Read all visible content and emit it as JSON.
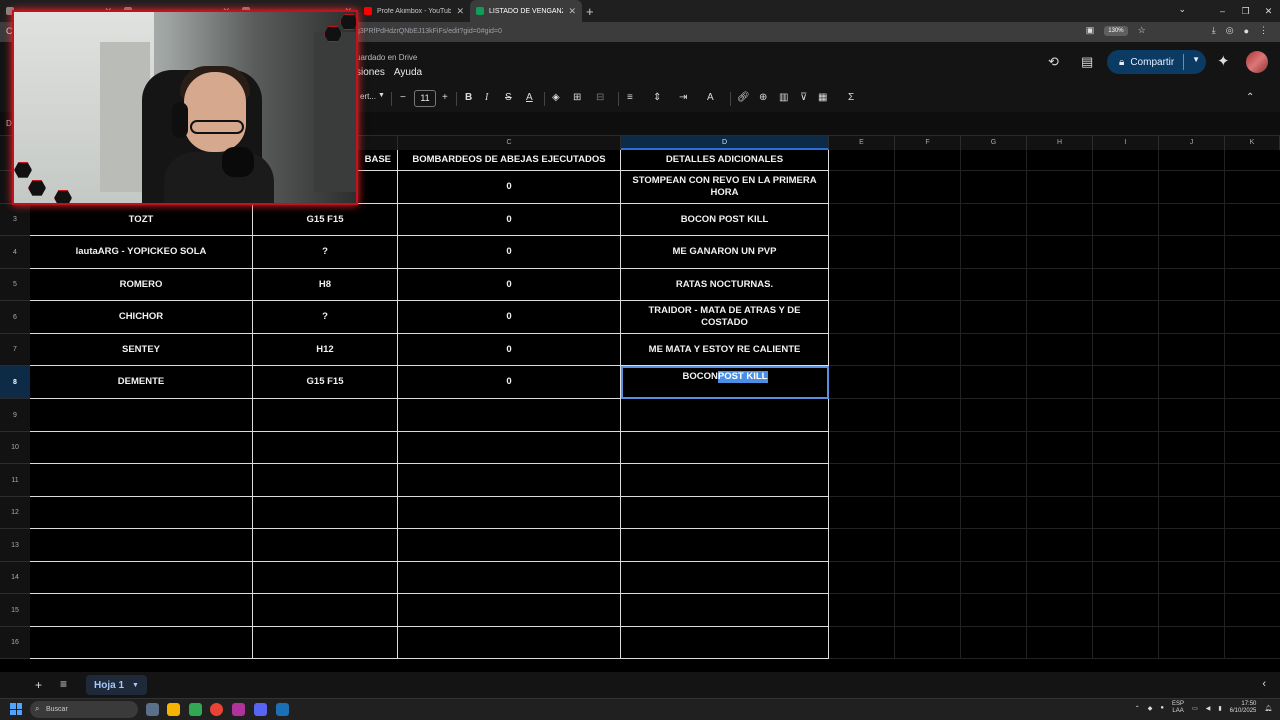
{
  "browser": {
    "tabs": [
      {
        "label": "Profe Akimbox - YouTube",
        "color": "#ff0000",
        "active": false
      },
      {
        "label": "LISTADO DE VENGANZA DE AB",
        "color": "#0f9d58",
        "active": true
      }
    ],
    "new_tab": "+",
    "url": "g3PRfPdHdzrQNbEJ13kFiFs/edit?gid=0#gid=0",
    "zoom": "130%"
  },
  "sheets": {
    "status": "uardado en Drive",
    "menu": [
      "siones",
      "Ayuda"
    ],
    "share_label": "Compartir",
    "font_partial": "ert...",
    "font_size": "11"
  },
  "columns": [
    {
      "letter": "C"
    },
    {
      "letter": "D"
    },
    {
      "letter": "E"
    },
    {
      "letter": "F"
    },
    {
      "letter": "G"
    },
    {
      "letter": "H"
    },
    {
      "letter": "I"
    },
    {
      "letter": "J"
    },
    {
      "letter": "K"
    }
  ],
  "table": {
    "header": {
      "b": "BASE",
      "c": "BOMBARDEOS DE ABEJAS EJECUTADOS",
      "d": "DETALLES ADICIONALES"
    },
    "rows": [
      {
        "num": "2",
        "a": "",
        "b": "",
        "c": "0",
        "d": "STOMPEAN CON REVO EN LA PRIMERA HORA"
      },
      {
        "num": "3",
        "a": "TOZT",
        "b": "G15 F15",
        "c": "0",
        "d": "BOCON POST KILL"
      },
      {
        "num": "4",
        "a": "lautaARG - YOPICKEO SOLA",
        "b": "?",
        "c": "0",
        "d": "ME GANARON UN PVP"
      },
      {
        "num": "5",
        "a": "ROMERO",
        "b": "H8",
        "c": "0",
        "d": "RATAS NOCTURNAS."
      },
      {
        "num": "6",
        "a": "CHICHOR",
        "b": "?",
        "c": "0",
        "d": "TRAIDOR - MATA DE ATRAS Y DE COSTADO"
      },
      {
        "num": "7",
        "a": "SENTEY",
        "b": "H12",
        "c": "0",
        "d": "ME MATA Y ESTOY RE CALIENTE"
      },
      {
        "num": "8",
        "a": "DEMENTE",
        "b": "G15 F15",
        "c": "0",
        "d_plain": "BOCON",
        "d_highlight": " POST KILL"
      }
    ],
    "empty_rows": [
      "9",
      "10",
      "11",
      "12",
      "13",
      "14",
      "15",
      "16"
    ]
  },
  "sheet_tab": {
    "label": "Hoja 1"
  },
  "taskbar": {
    "search_placeholder": "Buscar",
    "lang_1": "ESP",
    "lang_2": "LAA",
    "time": "17:50",
    "date": "6/10/2025"
  },
  "colors": {
    "accent": "#5b8fe0",
    "share_bg": "#0b3a63",
    "webcam_border": "#c1121f"
  }
}
